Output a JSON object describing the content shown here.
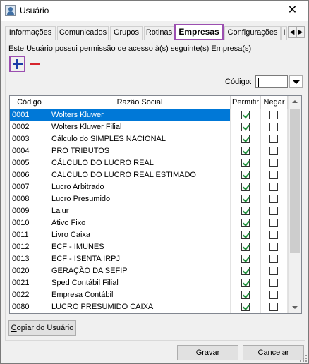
{
  "window": {
    "title": "Usuário",
    "close_symbol": "✕"
  },
  "tabs": [
    {
      "label": "Informações",
      "active": false
    },
    {
      "label": "Comunicados",
      "active": false
    },
    {
      "label": "Grupos",
      "active": false
    },
    {
      "label": "Rotinas",
      "active": false
    },
    {
      "label": "Empresas",
      "active": true
    },
    {
      "label": "Configurações",
      "active": false
    },
    {
      "label": "I",
      "active": false
    }
  ],
  "tab_scroll": {
    "left_symbol": "◀",
    "right_symbol": "▶"
  },
  "panel": {
    "permission_text": "Este Usuário possui permissão de acesso à(s) seguinte(s) Empresa(s)",
    "add_icon": "plus-icon",
    "remove_icon": "minus-icon",
    "codigo_label": "Código:",
    "codigo_value": ""
  },
  "grid": {
    "headers": [
      "Código",
      "Razão Social",
      "Permitir",
      "Negar"
    ],
    "rows": [
      {
        "code": "0001",
        "name": "Wolters Kluwer",
        "permitir": true,
        "negar": false,
        "selected": true
      },
      {
        "code": "0002",
        "name": "Wolters Kluwer Filial",
        "permitir": true,
        "negar": false
      },
      {
        "code": "0003",
        "name": "Cálculo do SIMPLES NACIONAL",
        "permitir": true,
        "negar": false
      },
      {
        "code": "0004",
        "name": "PRO TRIBUTOS",
        "permitir": true,
        "negar": false
      },
      {
        "code": "0005",
        "name": "CÁLCULO DO LUCRO REAL",
        "permitir": true,
        "negar": false
      },
      {
        "code": "0006",
        "name": "CALCULO DO LUCRO REAL ESTIMADO",
        "permitir": true,
        "negar": false
      },
      {
        "code": "0007",
        "name": "Lucro Arbitrado",
        "permitir": true,
        "negar": false
      },
      {
        "code": "0008",
        "name": "Lucro Presumido",
        "permitir": true,
        "negar": false
      },
      {
        "code": "0009",
        "name": "Lalur",
        "permitir": true,
        "negar": false
      },
      {
        "code": "0010",
        "name": "Ativo Fixo",
        "permitir": true,
        "negar": false
      },
      {
        "code": "0011",
        "name": "Livro Caixa",
        "permitir": true,
        "negar": false
      },
      {
        "code": "0012",
        "name": "ECF - IMUNES",
        "permitir": true,
        "negar": false
      },
      {
        "code": "0013",
        "name": "ECF - ISENTA IRPJ",
        "permitir": true,
        "negar": false
      },
      {
        "code": "0020",
        "name": "GERAÇÃO DA SEFIP",
        "permitir": true,
        "negar": false
      },
      {
        "code": "0021",
        "name": "Sped Contábil Filial",
        "permitir": true,
        "negar": false
      },
      {
        "code": "0022",
        "name": "Empresa Contábil",
        "permitir": true,
        "negar": false
      },
      {
        "code": "0080",
        "name": "LUCRO PRESUMIDO CAIXA",
        "permitir": true,
        "negar": false
      }
    ]
  },
  "buttons": {
    "copy_user": {
      "underlined": "C",
      "rest": "opiar do Usuário"
    },
    "save": {
      "underlined": "G",
      "rest": "ravar"
    },
    "cancel": {
      "underlined": "C",
      "rest": "ancelar"
    }
  },
  "colors": {
    "selection": "#0078d7",
    "highlight_border": "#9b4fb0",
    "add_icon": "#1c3ca8",
    "remove_icon": "#d6252d",
    "check_mark": "#1f8f3a"
  }
}
